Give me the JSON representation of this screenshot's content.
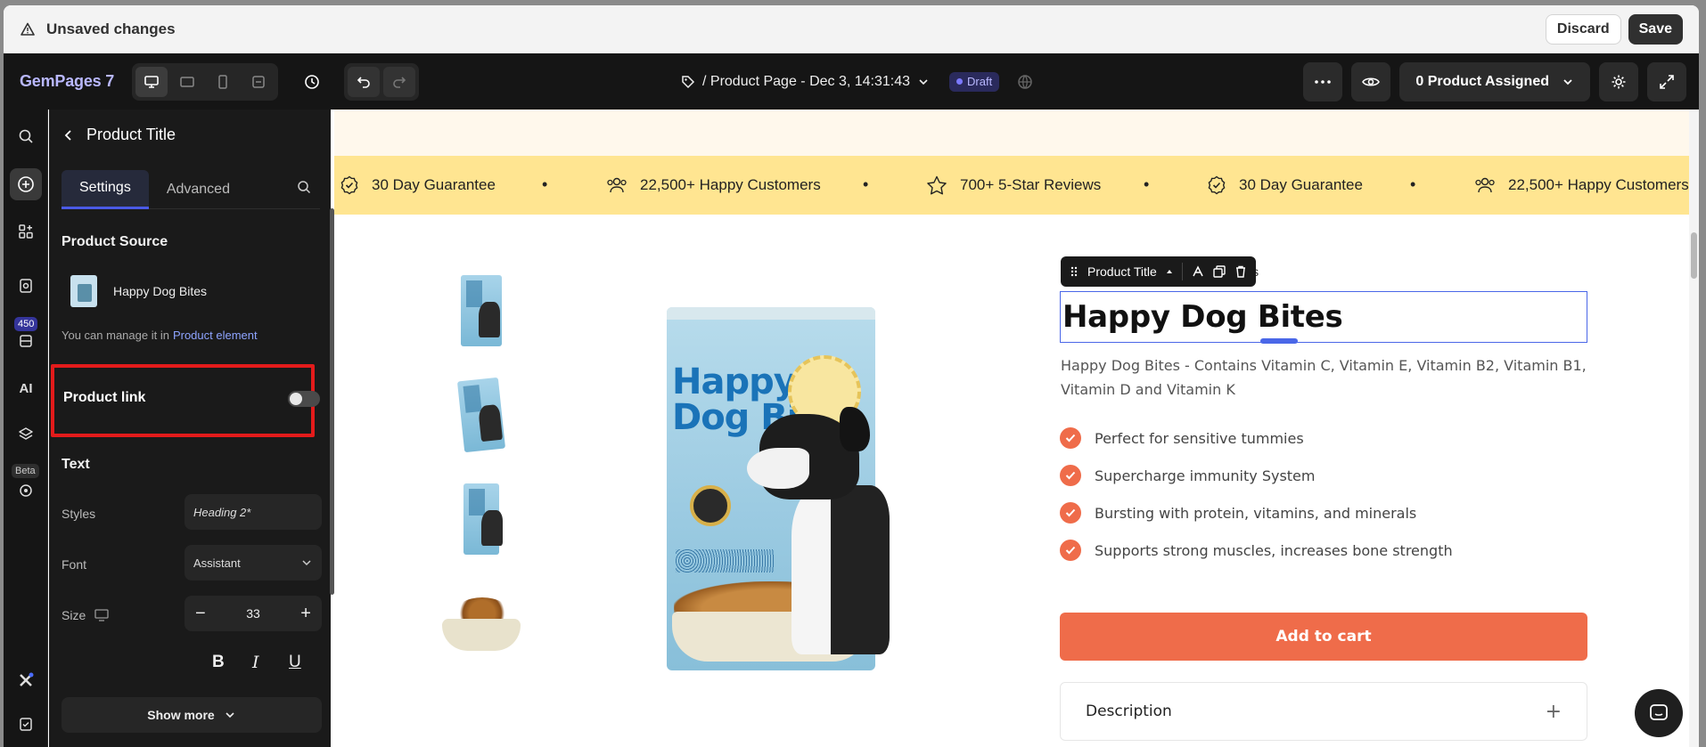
{
  "unsaved_bar": {
    "title": "Unsaved changes",
    "discard": "Discard",
    "save": "Save"
  },
  "topbar": {
    "logo": "GemPages 7",
    "page_name": "/ Product Page - Dec 3, 14:31:43",
    "status": "Draft",
    "assigned": "0 Product Assigned"
  },
  "rail": {
    "badge_count": "450",
    "beta": "Beta",
    "ai_label": "AI"
  },
  "panel": {
    "back_title": "Product Title",
    "tabs": [
      "Settings",
      "Advanced"
    ],
    "product_source_heading": "Product Source",
    "product_name": "Happy Dog Bites",
    "manage_text": "You can manage it in",
    "manage_link": "Product element",
    "product_link_label": "Product link",
    "product_link_on": false,
    "text_heading": "Text",
    "styles_label": "Styles",
    "styles_value": "Heading 2*",
    "font_label": "Font",
    "font_value": "Assistant",
    "size_label": "Size",
    "size_value": "33",
    "show_more": "Show more"
  },
  "canvas": {
    "ticker": [
      {
        "icon": "badge-check-icon",
        "text": "30 Day Guarantee"
      },
      {
        "icon": "users-icon",
        "text": "22,500+ Happy Customers"
      },
      {
        "icon": "star-icon",
        "text": "700+ 5-Star Reviews"
      },
      {
        "icon": "badge-check-icon",
        "text": "30 Day Guarantee"
      },
      {
        "icon": "users-icon",
        "text": "22,500+ Happy Customers"
      }
    ],
    "bag_text": "Happy Dog Bites",
    "toolbar_label": "Product Title",
    "behind_text": "mers",
    "product_title": "Happy Dog Bites",
    "description": "Happy Dog Bites - Contains Vitamin C, Vitamin E, Vitamin B2, Vitamin B1, Vitamin D and Vitamin K",
    "bullets": [
      "Perfect for sensitive tummies",
      "Supercharge immunity System",
      "Bursting with protein, vitamins, and minerals",
      "Supports strong muscles, increases bone strength"
    ],
    "add_to_cart": "Add to cart",
    "description_heading": "Description"
  },
  "colors": {
    "accent": "#ef6c4a",
    "ticker_bg": "#ffe591",
    "highlight": "#e31b1b",
    "brand": "#4a5ae8"
  }
}
